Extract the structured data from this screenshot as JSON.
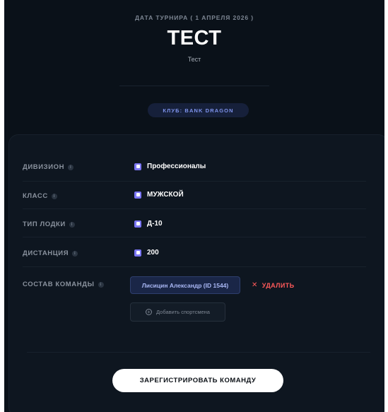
{
  "header": {
    "date_line": "ДАТА ТУРНИРА ( 1 АПРЕЛЯ 2026 )",
    "title": "ТЕСТ",
    "subtitle": "Тест",
    "club_badge": "КЛУБ: BANK DRAGON"
  },
  "form": {
    "rows": [
      {
        "label": "ДИВИЗИОН",
        "value": "Профессионалы",
        "checked": true
      },
      {
        "label": "КЛАСС",
        "value": "МУЖСКОЙ",
        "checked": true
      },
      {
        "label": "ТИП ЛОДКИ",
        "value": "Д-10",
        "checked": true
      },
      {
        "label": "ДИСТАНЦИЯ",
        "value": "200",
        "checked": true
      }
    ],
    "team": {
      "label": "СОСТАВ КОМАНДЫ",
      "members": [
        {
          "name": "Лисицин Александр (ID 1544)"
        }
      ],
      "delete_label": "УДАЛИТЬ",
      "add_label": "Добавить спортсмена"
    },
    "submit_label": "ЗАРЕГИСТРИРОВАТЬ КОМАНДУ"
  },
  "icons": {
    "info": "info-icon",
    "checkbox": "checkbox-icon",
    "delete": "close-icon",
    "add": "plus-circle-icon"
  },
  "colors": {
    "background": "#0a1119",
    "panel": "#0e1620",
    "accent": "#7b76f3",
    "badge_text": "#7e93ec",
    "danger": "#ff5a5a"
  }
}
